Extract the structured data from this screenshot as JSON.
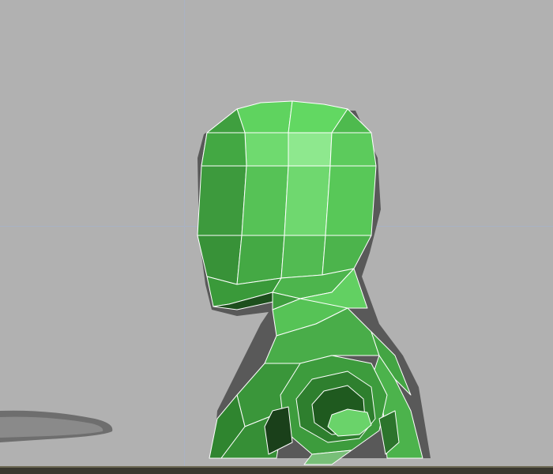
{
  "viewport": {
    "label": "",
    "background_color": "#b1b1b1",
    "grid_color": "#a9b2c4",
    "model_color": "#4caf50",
    "wire_color": "#ffffff"
  },
  "scene_objects": [
    "character-mesh",
    "side-object"
  ]
}
